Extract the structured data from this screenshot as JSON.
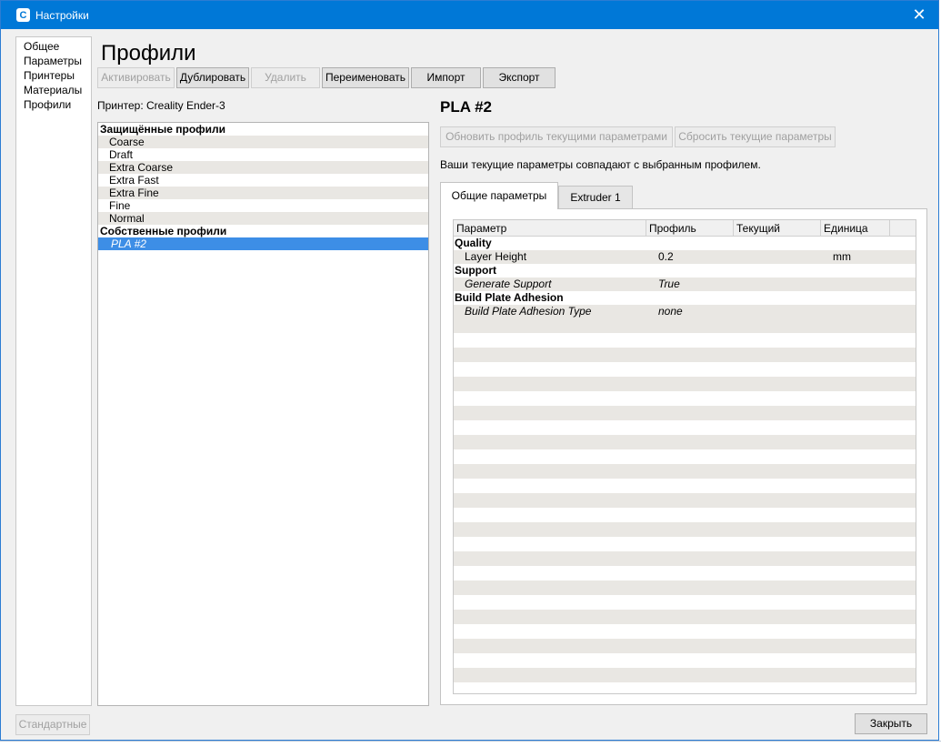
{
  "window": {
    "title": "Настройки",
    "app_icon": "cura-app-icon",
    "close_icon": "close-icon"
  },
  "sidebar": {
    "items": [
      {
        "label": "Общее"
      },
      {
        "label": "Параметры"
      },
      {
        "label": "Принтеры"
      },
      {
        "label": "Материалы"
      },
      {
        "label": "Профили"
      }
    ]
  },
  "page": {
    "title": "Профили"
  },
  "toolbar": {
    "activate": "Активировать",
    "duplicate": "Дублировать",
    "delete": "Удалить",
    "rename": "Переименовать",
    "import": "Импорт",
    "export": "Экспорт"
  },
  "printer_label": "Принтер: Creality Ender-3",
  "profile_list": {
    "protected_header": "Защищённые профили",
    "protected": [
      "Coarse",
      "Draft",
      "Extra Coarse",
      "Extra Fast",
      "Extra Fine",
      "Fine",
      "Normal"
    ],
    "custom_header": "Собственные профили",
    "custom": [
      "PLA #2"
    ]
  },
  "details": {
    "profile_name": "PLA #2",
    "update_button": "Обновить профиль текущими параметрами",
    "reset_button": "Сбросить текущие параметры",
    "match_text": "Ваши текущие параметры совпадают с выбранным профилем.",
    "tabs": [
      "Общие параметры",
      "Extruder 1"
    ],
    "grid": {
      "headers": [
        "Параметр",
        "Профиль",
        "Текущий",
        "Единица"
      ],
      "rows": [
        {
          "kind": "category",
          "label": "Quality"
        },
        {
          "kind": "setting",
          "label": "Layer Height",
          "profile": "0.2",
          "current": "",
          "unit": "mm",
          "italic": false
        },
        {
          "kind": "category",
          "label": "Support"
        },
        {
          "kind": "setting",
          "label": "Generate Support",
          "profile": "True",
          "current": "",
          "unit": "",
          "italic": true
        },
        {
          "kind": "category",
          "label": "Build Plate Adhesion"
        },
        {
          "kind": "setting",
          "label": "Build Plate Adhesion Type",
          "profile": "none",
          "current": "",
          "unit": "",
          "italic": true
        }
      ]
    }
  },
  "footer": {
    "defaults_button": "Стандартные",
    "close_button": "Закрыть"
  }
}
